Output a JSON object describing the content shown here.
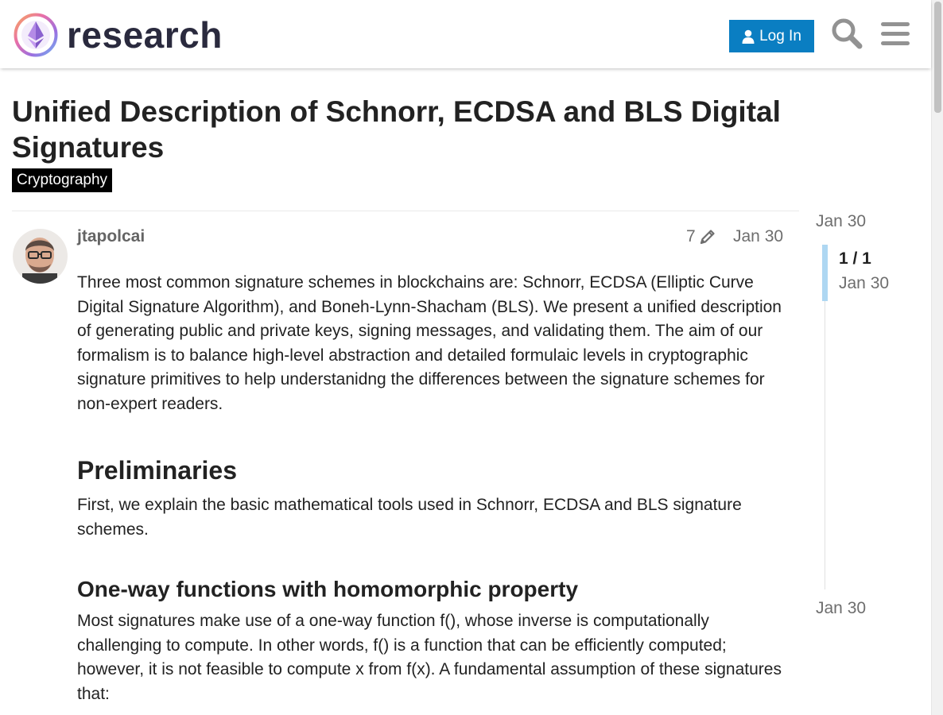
{
  "site": {
    "name": "research",
    "logo_icon": "ethereum-research-logo",
    "login_label": "Log In",
    "accent_color": "#0a7ec2"
  },
  "header": {
    "icons": [
      "user-icon",
      "search-icon",
      "hamburger-menu-icon"
    ]
  },
  "topic": {
    "title": "Unified Description of Schnorr, ECDSA and BLS Digital Signatures",
    "category": "Cryptography",
    "category_color": "#000000"
  },
  "post": {
    "username": "jtapolcai",
    "edit_count": "7",
    "date": "Jan 30",
    "intro": "Three most common signature schemes in blockchains are: Schnorr, ECDSA (Elliptic Curve Digital Signature Algorithm), and Boneh-Lynn-Shacham (BLS). We present a unified description of generating public and private keys, signing messages, and validating them. The aim of our formalism is to balance high-level abstraction and detailed formulaic levels in cryptographic signature primitives to help understanidng the differences between the signature schemes for non-expert readers.",
    "h_preliminaries": "Preliminaries",
    "p_preliminaries": "First, we explain the basic mathematical tools used in Schnorr, ECDSA and BLS signature schemes.",
    "h_oneway": "One-way functions with homomorphic property",
    "p_oneway": "Most signatures make use of a one-way function f(), whose inverse is computationally challenging to compute. In other words, f() is a function that can be efficiently computed; however, it is not feasible to compute x from f(x). A fundamental assumption of these signatures that:"
  },
  "timeline": {
    "top_date": "Jan 30",
    "position": "1 / 1",
    "handle_date": "Jan 30",
    "bottom_date": "Jan 30"
  }
}
